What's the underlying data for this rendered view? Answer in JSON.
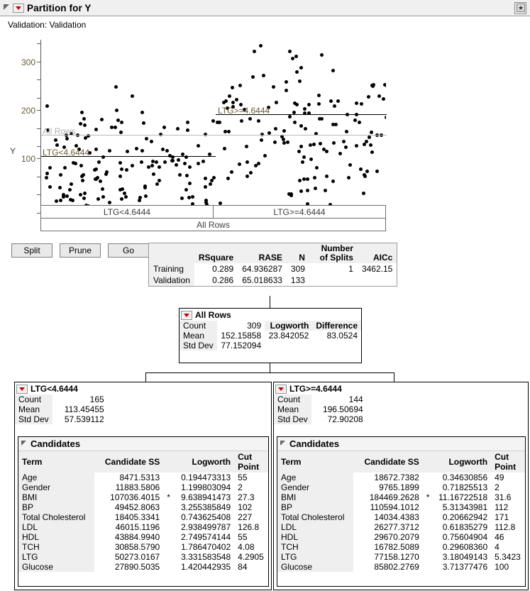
{
  "window": {
    "title": "Partition for Y",
    "disclosure_icon": "triangle-open-icon",
    "red_menu_icon": "red-triangle-menu-icon",
    "corner_button_icon": "window-restore-icon"
  },
  "validation": {
    "text": "Validation: Validation"
  },
  "plot": {
    "y_axis_label": "Y",
    "y_ticks": [
      "300",
      "200",
      "100"
    ],
    "fit_labels": {
      "all_rows": "All Rows",
      "left": "LTG<4.6444",
      "right": "LTG>=4.6444"
    },
    "split_bars": {
      "left": "LTG<4.6444",
      "right": "LTG>=4.6444",
      "root": "All Rows"
    }
  },
  "toolbar": {
    "split_label": "Split",
    "prune_label": "Prune",
    "go_label": "Go"
  },
  "fit_stats": {
    "columns": [
      "",
      "RSquare",
      "RASE",
      "N",
      "Number of Splits",
      "AICc"
    ],
    "rows": [
      {
        "label": "Training",
        "rsquare": "0.289",
        "rase": "64.936287",
        "n": "309",
        "splits": "1",
        "aicc": "3462.15"
      },
      {
        "label": "Validation",
        "rsquare": "0.286",
        "rase": "65.018633",
        "n": "133",
        "splits": "",
        "aicc": ""
      }
    ]
  },
  "tree": {
    "root": {
      "title": "All Rows",
      "count_label": "Count",
      "count_value": "309",
      "mean_label": "Mean",
      "mean_value": "152.15858",
      "sd_label": "Std Dev",
      "sd_value": "77.152094",
      "logworth_label": "Logworth",
      "logworth_value": "23.842052",
      "difference_label": "Difference",
      "difference_value": "83.0524"
    },
    "left": {
      "title": "LTG<4.6444",
      "count_label": "Count",
      "count_value": "165",
      "mean_label": "Mean",
      "mean_value": "113.45455",
      "sd_label": "Std Dev",
      "sd_value": "57.539112"
    },
    "right": {
      "title": "LTG>=4.6444",
      "count_label": "Count",
      "count_value": "144",
      "mean_label": "Mean",
      "mean_value": "196.50694",
      "sd_label": "Std Dev",
      "sd_value": "72.90208"
    }
  },
  "candidates_left": {
    "title": "Candidates",
    "columns": [
      "Term",
      "Candidate SS",
      "",
      "Logworth",
      "Cut Point"
    ],
    "rows": [
      {
        "term": "Age",
        "ss": "8471.5313",
        "star": "",
        "logworth": "0.194473313",
        "cut": "55"
      },
      {
        "term": "Gender",
        "ss": "11883.5806",
        "star": "",
        "logworth": "1.199803094",
        "cut": "2"
      },
      {
        "term": "BMI",
        "ss": "107036.4015",
        "star": "*",
        "logworth": "9.638941473",
        "cut": "27.3"
      },
      {
        "term": "BP",
        "ss": "49452.8063",
        "star": "",
        "logworth": "3.255385849",
        "cut": "102"
      },
      {
        "term": "Total Cholesterol",
        "ss": "18405.3341",
        "star": "",
        "logworth": "0.743625408",
        "cut": "227"
      },
      {
        "term": "LDL",
        "ss": "46015.1196",
        "star": "",
        "logworth": "2.938499787",
        "cut": "126.8"
      },
      {
        "term": "HDL",
        "ss": "43884.9940",
        "star": "",
        "logworth": "2.749574144",
        "cut": "55"
      },
      {
        "term": "TCH",
        "ss": "30858.5790",
        "star": "",
        "logworth": "1.786470402",
        "cut": "4.08"
      },
      {
        "term": "LTG",
        "ss": "50273.0167",
        "star": "",
        "logworth": "3.331583548",
        "cut": "4.2905"
      },
      {
        "term": "Glucose",
        "ss": "27890.5035",
        "star": "",
        "logworth": "1.420442935",
        "cut": "84"
      }
    ]
  },
  "candidates_right": {
    "title": "Candidates",
    "columns": [
      "Term",
      "Candidate SS",
      "",
      "Logworth",
      "Cut Point"
    ],
    "rows": [
      {
        "term": "Age",
        "ss": "18672.7382",
        "star": "",
        "logworth": "0.34630856",
        "cut": "49"
      },
      {
        "term": "Gender",
        "ss": "9765.1899",
        "star": "",
        "logworth": "0.71825513",
        "cut": "2"
      },
      {
        "term": "BMI",
        "ss": "184469.2628",
        "star": "*",
        "logworth": "11.16722518",
        "cut": "31.6"
      },
      {
        "term": "BP",
        "ss": "110594.1012",
        "star": "",
        "logworth": "5.31343981",
        "cut": "112"
      },
      {
        "term": "Total Cholesterol",
        "ss": "14034.4383",
        "star": "",
        "logworth": "0.20662942",
        "cut": "171"
      },
      {
        "term": "LDL",
        "ss": "26277.3712",
        "star": "",
        "logworth": "0.61835279",
        "cut": "112.8"
      },
      {
        "term": "HDL",
        "ss": "29670.2079",
        "star": "",
        "logworth": "0.75604904",
        "cut": "46"
      },
      {
        "term": "TCH",
        "ss": "16782.5089",
        "star": "",
        "logworth": "0.29608360",
        "cut": "4"
      },
      {
        "term": "LTG",
        "ss": "77158.1270",
        "star": "",
        "logworth": "3.18049143",
        "cut": "5.3423"
      },
      {
        "term": "Glucose",
        "ss": "85802.2769",
        "star": "",
        "logworth": "3.71377476",
        "cut": "100"
      }
    ]
  },
  "chart_data": {
    "type": "scatter",
    "title": "Partition for Y",
    "xlabel": "",
    "ylabel": "Y",
    "ylim": [
      25,
      360
    ],
    "yticks": [
      100,
      200,
      300
    ],
    "grid": false,
    "legend": null,
    "n_points": 309,
    "annotations": [
      {
        "text": "All Rows",
        "value": 152.15858,
        "type": "mean-line-all"
      },
      {
        "text": "LTG<4.6444",
        "value": 113.45455,
        "type": "mean-line-left",
        "x_range": [
          0,
          0.5
        ]
      },
      {
        "text": "LTG>=4.6444",
        "value": 196.50694,
        "type": "mean-line-right",
        "x_range": [
          0.5,
          1
        ]
      }
    ],
    "groups": [
      {
        "name": "LTG<4.6444",
        "count": 165,
        "mean": 113.45455,
        "std": 57.539112
      },
      {
        "name": "LTG>=4.6444",
        "count": 144,
        "mean": 196.50694,
        "std": 72.90208
      }
    ]
  }
}
